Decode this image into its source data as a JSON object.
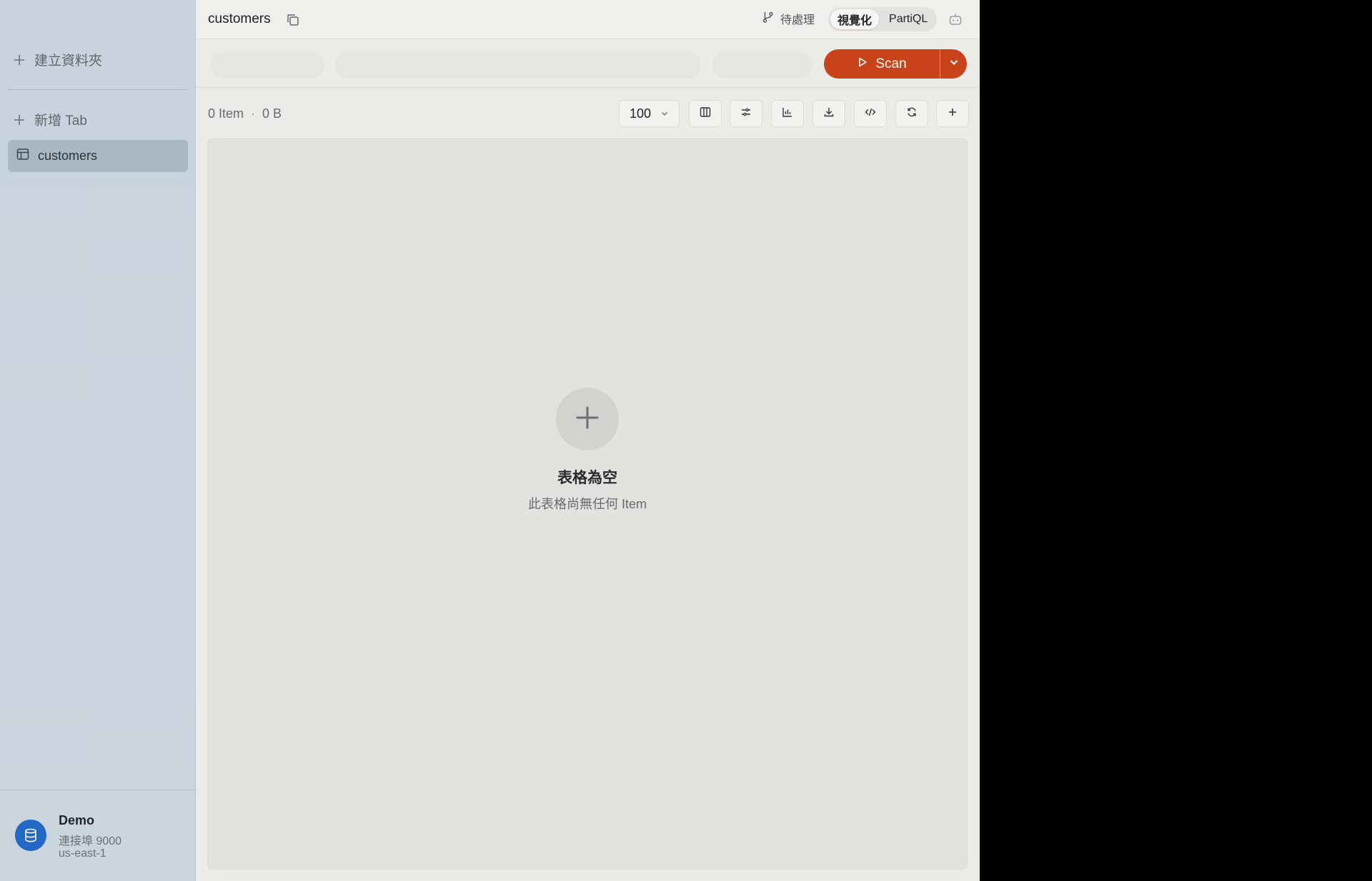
{
  "sidebar": {
    "create_folder_label": "建立資料夾",
    "new_tab_label": "新增 Tab",
    "items": [
      {
        "label": "customers",
        "icon": "table-icon",
        "active": true
      }
    ],
    "connection": {
      "name": "Demo",
      "port_label": "連接埠 9000",
      "region": "us-east-1",
      "icon": "database-icon"
    }
  },
  "header": {
    "tab_title": "customers",
    "pending_label": "待處理",
    "modes": [
      "視覺化",
      "PartiQL"
    ],
    "active_mode": "視覺化"
  },
  "query": {
    "scan_label": "Scan",
    "accent_color": "#c9431a"
  },
  "stats": {
    "item_count": "0 Item",
    "separator": "·",
    "size": "0 B",
    "limit": "100"
  },
  "toolbar": {
    "buttons": [
      "columns-icon",
      "filter-icon",
      "chart-icon",
      "download-icon",
      "code-icon",
      "refresh-icon",
      "add-icon"
    ]
  },
  "empty_state": {
    "title": "表格為空",
    "subtitle": "此表格尚無任何 Item"
  }
}
